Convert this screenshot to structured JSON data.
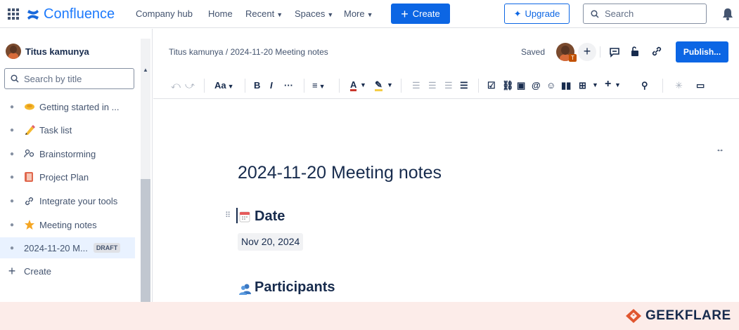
{
  "topnav": {
    "brand": "Confluence",
    "items": [
      {
        "label": "Company hub"
      },
      {
        "label": "Home"
      },
      {
        "label": "Recent",
        "has_chevron": true
      },
      {
        "label": "Spaces",
        "has_chevron": true
      },
      {
        "label": "More",
        "has_chevron": true
      }
    ],
    "create_label": "Create",
    "upgrade_label": "Upgrade",
    "search_placeholder": "Search"
  },
  "sidebar": {
    "space_name": "Titus kamunya",
    "search_placeholder": "Search by title",
    "items": [
      {
        "label": "Getting started in ...",
        "icon": "handshake-emoji"
      },
      {
        "label": "Task list",
        "icon": "pencil-emoji"
      },
      {
        "label": "Brainstorming",
        "icon": "people-icon"
      },
      {
        "label": "Project Plan",
        "icon": "notebook-emoji"
      },
      {
        "label": "Integrate your tools",
        "icon": "link-icon"
      },
      {
        "label": "Meeting notes",
        "icon": "star-emoji"
      },
      {
        "label": "2024-11-20 M...",
        "badge": "DRAFT",
        "active": true
      }
    ],
    "create_label": "Create"
  },
  "page_header": {
    "breadcrumb": "Titus kamunya  /  2024-11-20 Meeting notes",
    "status": "Saved",
    "avatar_initial": "T",
    "publish_label": "Publish..."
  },
  "toolbar": {
    "text_style_label": "Aa"
  },
  "document": {
    "title": "2024-11-20 Meeting notes",
    "date_heading": "Date",
    "date_value": "Nov 20, 2024",
    "participants_heading": "Participants"
  },
  "footer": {
    "brand": "GEEKFLARE"
  },
  "colors": {
    "accent": "#0c66e4",
    "text": "#172b4d",
    "muted": "#44546f",
    "footer_band": "#fcece9",
    "footer_brand": "#e0562f"
  }
}
